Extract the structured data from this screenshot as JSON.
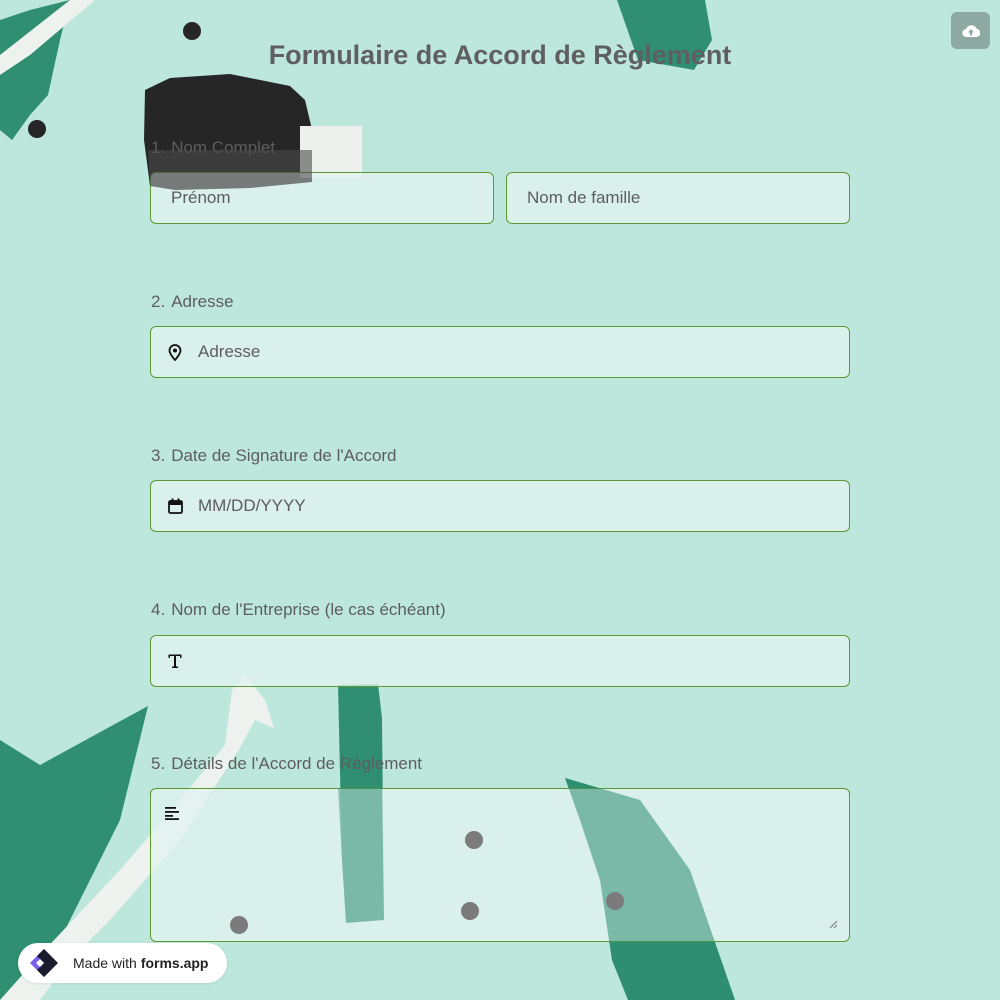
{
  "form": {
    "title": "Formulaire de Accord de Règlement"
  },
  "questions": [
    {
      "number": "1.",
      "label": "Nom Complet",
      "fields": [
        {
          "placeholder": "Prénom"
        },
        {
          "placeholder": "Nom de famille"
        }
      ]
    },
    {
      "number": "2.",
      "label": "Adresse",
      "icon": "location-pin-icon",
      "placeholder": "Adresse"
    },
    {
      "number": "3.",
      "label": "Date de Signature de l'Accord",
      "icon": "calendar-icon",
      "placeholder": "MM/DD/YYYY"
    },
    {
      "number": "4.",
      "label": "Nom de l'Entreprise (le cas échéant)",
      "icon": "text-type-icon",
      "placeholder": ""
    },
    {
      "number": "5.",
      "label": "Détails de l'Accord de Règlement",
      "icon": "align-left-icon",
      "placeholder": ""
    }
  ],
  "footer": {
    "badge_prefix": "Made with",
    "badge_brand": "forms.app"
  },
  "toolbar": {
    "upload_icon": "cloud-upload-icon"
  },
  "colors": {
    "background": "#bde7dc",
    "accent_green": "#2f8f70",
    "field_border": "#5d9a34",
    "field_fill": "#e1f4ef"
  }
}
